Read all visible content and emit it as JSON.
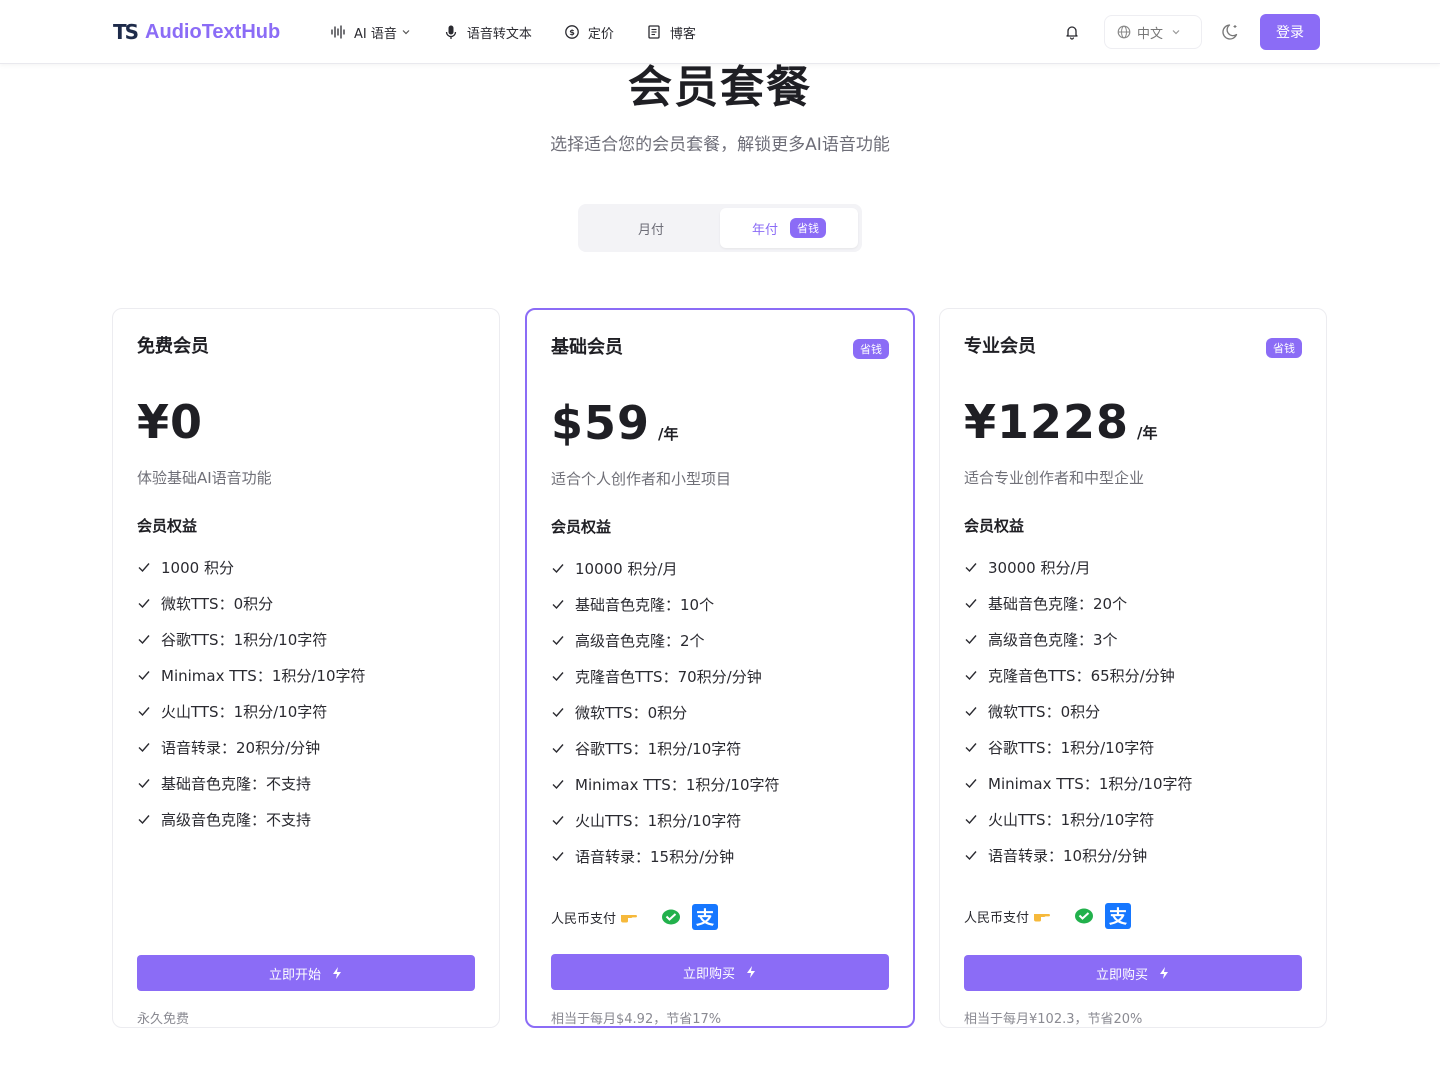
{
  "navbar": {
    "logo_mark": "TS",
    "brand": "AudioTextHub",
    "links": [
      {
        "label": "AI 语音",
        "icon": "waveform-icon",
        "dropdown": true
      },
      {
        "label": "语音转文本",
        "icon": "microphone-icon"
      },
      {
        "label": "定价",
        "icon": "dollar-circle-icon"
      },
      {
        "label": "博客",
        "icon": "document-icon"
      }
    ],
    "language": "中文",
    "login_label": "登录"
  },
  "header": {
    "title": "会员套餐",
    "subtitle": "选择适合您的会员套餐，解锁更多AI语音功能"
  },
  "billing_toggle": {
    "monthly_label": "月付",
    "yearly_label": "年付",
    "yearly_badge": "省钱",
    "active": "yearly"
  },
  "plans": [
    {
      "name": "免费会员",
      "badge": "",
      "price": "¥0",
      "period": "",
      "description": "体验基础AI语音功能",
      "features_title": "会员权益",
      "features": [
        "1000 积分",
        "微软TTS：0积分",
        "谷歌TTS：1积分/10字符",
        "Minimax TTS：1积分/10字符",
        "火山TTS：1积分/10字符",
        "语音转录：20积分/分钟",
        "基础音色克隆：不支持",
        "高级音色克隆：不支持"
      ],
      "payment_label": "",
      "cta": "立即开始",
      "note": "永久免费"
    },
    {
      "name": "基础会员",
      "badge": "省钱",
      "price": "$59",
      "period": "/年",
      "description": "适合个人创作者和小型项目",
      "features_title": "会员权益",
      "features": [
        "10000 积分/月",
        "基础音色克隆：10个",
        "高级音色克隆：2个",
        "克隆音色TTS：70积分/分钟",
        "微软TTS：0积分",
        "谷歌TTS：1积分/10字符",
        "Minimax TTS：1积分/10字符",
        "火山TTS：1积分/10字符",
        "语音转录：15积分/分钟"
      ],
      "payment_label": "人民币支付",
      "cta": "立即购买",
      "note": "相当于每月$4.92，节省17%"
    },
    {
      "name": "专业会员",
      "badge": "省钱",
      "price": "¥1228",
      "period": "/年",
      "description": "适合专业创作者和中型企业",
      "features_title": "会员权益",
      "features": [
        "30000 积分/月",
        "基础音色克隆：20个",
        "高级音色克隆：3个",
        "克隆音色TTS：65积分/分钟",
        "微软TTS：0积分",
        "谷歌TTS：1积分/10字符",
        "Minimax TTS：1积分/10字符",
        "火山TTS：1积分/10字符",
        "语音转录：10积分/分钟"
      ],
      "payment_label": "人民币支付",
      "cta": "立即购买",
      "note": "相当于每月¥102.3，节省20%"
    }
  ],
  "colors": {
    "accent": "#8b6cf6",
    "text": "#1f1f24",
    "muted": "#707078",
    "wechat": "#22b14c",
    "alipay": "#1677ff"
  }
}
